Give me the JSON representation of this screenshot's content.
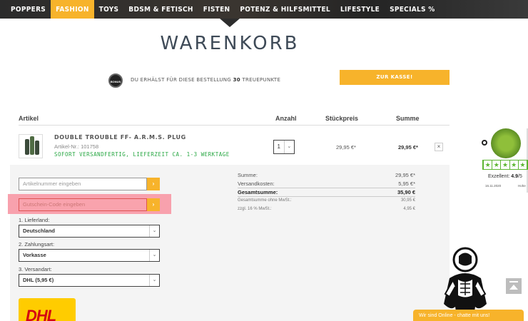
{
  "nav": {
    "items": [
      {
        "label": "POPPERS",
        "active": false
      },
      {
        "label": "FASHION",
        "active": true
      },
      {
        "label": "TOYS",
        "active": false
      },
      {
        "label": "BDSM & FETISCH",
        "active": false
      },
      {
        "label": "FISTEN",
        "active": false
      },
      {
        "label": "POTENZ & HILFSMITTEL",
        "active": false
      },
      {
        "label": "LIFESTYLE",
        "active": false
      },
      {
        "label": "SPECIALS %",
        "active": false
      }
    ]
  },
  "page_title": "WARENKORB",
  "bonus": {
    "badge": "BONUS",
    "text_before": "DU ERHÄLST FÜR DIESE BESTELLUNG ",
    "points": "30",
    "text_after": " TREUEPUNKTE"
  },
  "checkout_button": "ZUR KASSE!",
  "table_header": {
    "article": "Artikel",
    "quantity": "Anzahl",
    "unit_price": "Stückpreis",
    "sum": "Summe"
  },
  "item": {
    "name": "DOUBLE TROUBLE FF- A.R.M.S. PLUG",
    "article_nr": "Artikel-Nr.: 101758",
    "shipping": "SOFORT VERSANDFERTIG, LIEFERZEIT CA. 1-3 WERKTAGE",
    "quantity": "1",
    "unit_price": "29,95 €*",
    "sum": "29,95 €*",
    "remove": "×"
  },
  "forms": {
    "article_placeholder": "Artikelnummer eingeben",
    "voucher_placeholder": "Gutschein-Code eingeben",
    "go_icon": "›",
    "country_label": "1. Lieferland:",
    "country_value": "Deutschland",
    "payment_label": "2. Zahlungsart:",
    "payment_value": "Vorkasse",
    "shipping_label": "3. Versandart:",
    "shipping_value": "DHL (5,95 €)",
    "dropdown_icon": "⌄"
  },
  "dhl_logo": "DHL",
  "summary": {
    "rows": [
      {
        "label": "Summe:",
        "value": "29,95 €*",
        "style": ""
      },
      {
        "label": "Versandkosten:",
        "value": "5,95 €*",
        "style": ""
      },
      {
        "label": "Gesamtsumme:",
        "value": "35,90 €",
        "style": "b"
      },
      {
        "label": "Gesamtsumme ohne MwSt.:",
        "value": "30,95 €",
        "style": "s"
      },
      {
        "label": "zzgl. 16 % MwSt.:",
        "value": "4,95 €",
        "style": "s"
      }
    ]
  },
  "reviews": {
    "stars": [
      "★",
      "★",
      "★",
      "★",
      "★"
    ],
    "excellent_label": "Exzellent: ",
    "score": "4.9",
    "max": "/5",
    "date": "16.11.2020",
    "verified": "Hohe"
  },
  "chat": {
    "label": "Wir sind Online - chatte mit uns!"
  },
  "colors": {
    "accent": "#f7b32b",
    "highlight": "#f8a1ad",
    "success": "#2aa845",
    "trusted": "#5cb531"
  }
}
